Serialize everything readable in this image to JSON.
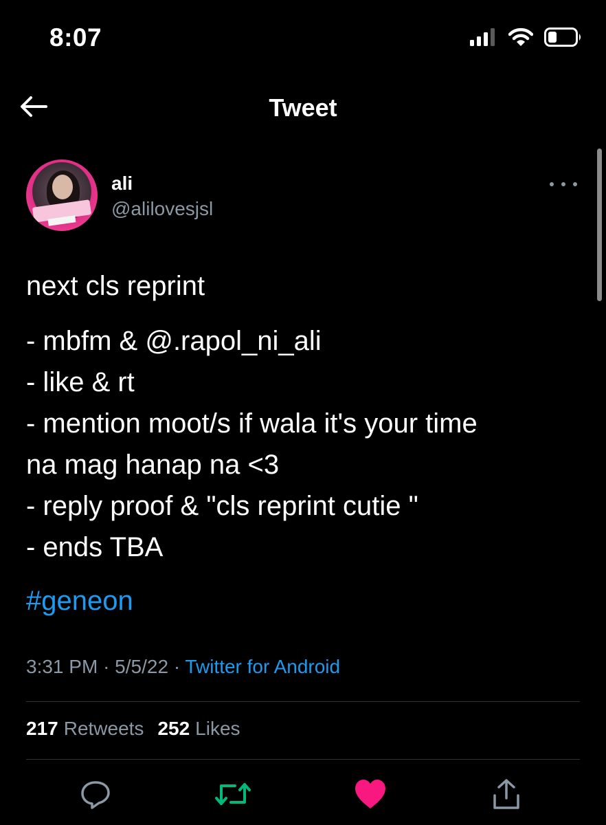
{
  "status_bar": {
    "time": "8:07"
  },
  "header": {
    "title": "Tweet"
  },
  "tweet": {
    "author_name": "ali",
    "author_handle": "@alilovesjsl",
    "lines": [
      "next cls reprint",
      "- mbfm & @.rapol_ni_ali",
      "- like & rt",
      "- mention moot/s if wala it's your time",
      "na mag hanap na <3",
      "- reply proof & \"cls reprint cutie \"",
      "- ends TBA"
    ],
    "hashtag": "#geneon",
    "time": "3:31 PM",
    "date": "5/5/22",
    "source": "Twitter for Android",
    "retweets_count": "217",
    "retweets_label": "Retweets",
    "likes_count": "252",
    "likes_label": "Likes"
  },
  "colors": {
    "background": "#000000",
    "link": "#1d9bf0",
    "secondary_text": "#8b98a5",
    "retweet_active": "#00ba7c",
    "like_active": "#f91880"
  },
  "icons": {
    "back": "arrow-left-icon",
    "more": "more-horizontal-icon",
    "reply": "reply-icon",
    "retweet": "retweet-icon",
    "like": "heart-icon",
    "share": "share-icon"
  }
}
